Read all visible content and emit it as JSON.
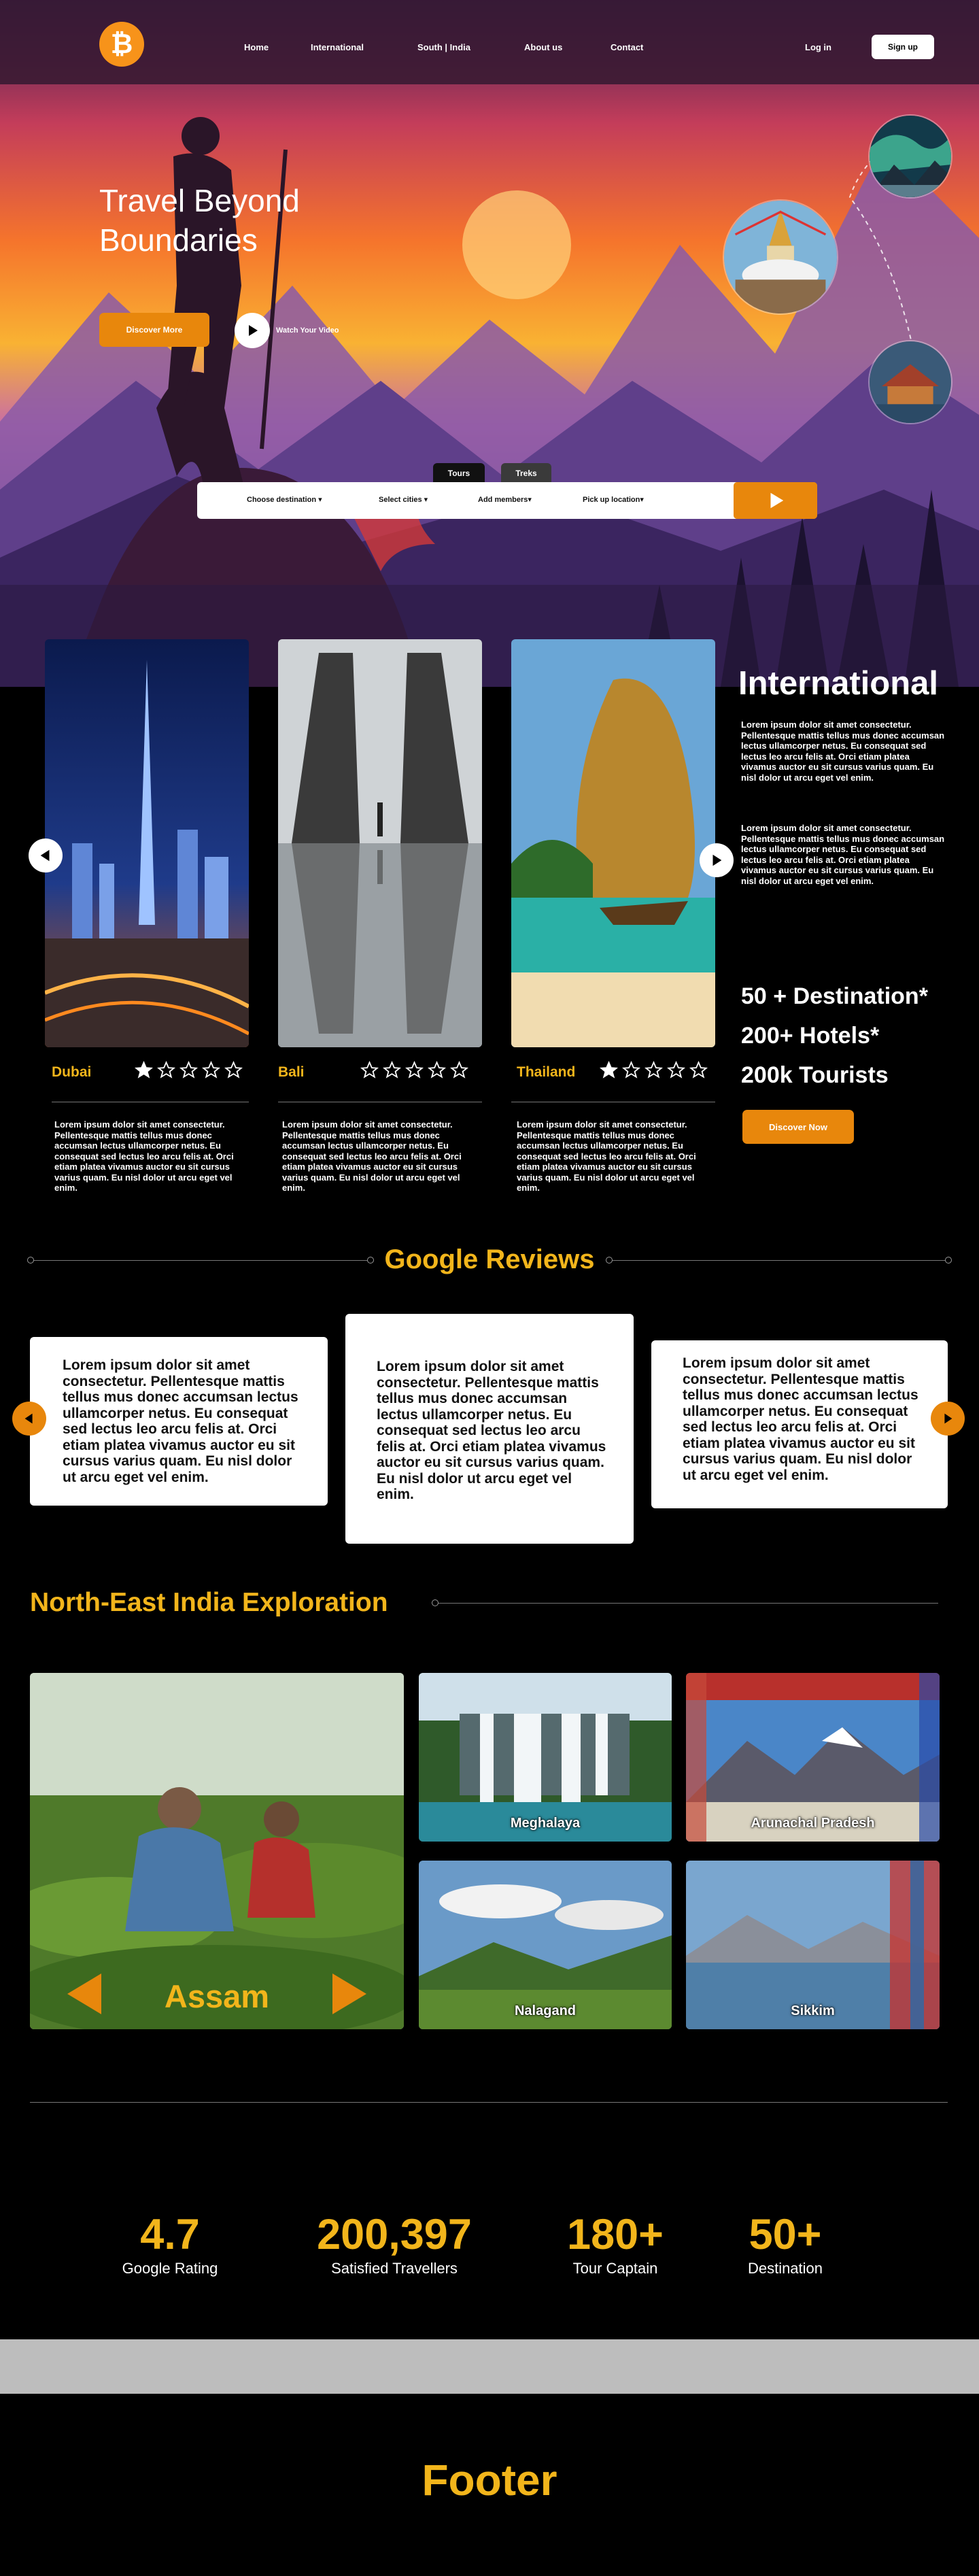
{
  "brand": {
    "logo_glyph": "₿",
    "accent": "#e8870c",
    "gold": "#f2b51b"
  },
  "nav": {
    "links": [
      "Home",
      "International",
      "South | India",
      "About us",
      "Contact"
    ],
    "login": "Log in",
    "signup": "Sign up"
  },
  "hero": {
    "title": "Travel Beyond Boundaries",
    "discover_label": "Discover More",
    "watch_label": "Watch Your Video",
    "play_icon": "play-icon"
  },
  "search": {
    "tabs": [
      "Tours",
      "Treks"
    ],
    "fields": [
      "Choose destination ▾",
      "Select cities ▾",
      "Add members▾",
      "Pick up location▾"
    ],
    "go_icon": "play-icon"
  },
  "destinations": [
    {
      "name": "Dubai",
      "rating": 1,
      "description": "Lorem ipsum dolor sit amet consectetur. Pellentesque mattis tellus mus donec accumsan lectus ullamcorper netus. Eu consequat sed lectus leo arcu felis at. Orci etiam platea vivamus auctor eu sit cursus varius quam. Eu nisl dolor ut arcu eget vel enim."
    },
    {
      "name": "Bali",
      "rating": 0,
      "description": "Lorem ipsum dolor sit amet consectetur. Pellentesque mattis tellus mus donec accumsan lectus ullamcorper netus. Eu consequat sed lectus leo arcu felis at. Orci etiam platea vivamus auctor eu sit cursus varius quam. Eu nisl dolor ut arcu eget vel enim."
    },
    {
      "name": "Thailand",
      "rating": 1,
      "description": "Lorem ipsum dolor sit amet consectetur. Pellentesque mattis tellus mus donec accumsan lectus ullamcorper netus. Eu consequat sed lectus leo arcu felis at. Orci etiam platea vivamus auctor eu sit cursus varius quam. Eu nisl dolor ut arcu eget vel enim."
    }
  ],
  "international": {
    "title": "International",
    "paragraphs": [
      "Lorem ipsum dolor sit amet consectetur. Pellentesque mattis tellus mus donec accumsan lectus ullamcorper netus. Eu consequat sed lectus leo arcu felis at. Orci etiam platea vivamus auctor eu sit cursus varius quam. Eu nisl dolor ut arcu eget vel enim.",
      "Lorem ipsum dolor sit amet consectetur. Pellentesque mattis tellus mus donec accumsan lectus ullamcorper netus. Eu consequat sed lectus leo arcu felis at. Orci etiam platea vivamus auctor eu sit cursus varius quam. Eu nisl dolor ut arcu eget vel enim."
    ],
    "stats": [
      "50 + Destination*",
      "200+ Hotels*",
      "200k Tourists"
    ],
    "cta": "Discover Now"
  },
  "reviews": {
    "title": "Google Reviews",
    "items": [
      "Lorem ipsum dolor sit amet consectetur. Pellentesque mattis tellus mus donec accumsan lectus ullamcorper netus. Eu consequat sed lectus leo arcu felis at. Orci etiam platea vivamus auctor eu sit cursus varius quam. Eu nisl dolor ut arcu eget vel enim.",
      "Lorem ipsum dolor sit amet consectetur. Pellentesque mattis tellus mus donec accumsan lectus ullamcorper netus. Eu consequat sed lectus leo arcu felis at. Orci etiam platea vivamus auctor eu sit cursus varius quam. Eu nisl dolor ut arcu eget vel enim.",
      "Lorem ipsum dolor sit amet consectetur. Pellentesque mattis tellus mus donec accumsan lectus ullamcorper netus. Eu consequat sed lectus leo arcu felis at. Orci etiam platea vivamus auctor eu sit cursus varius quam. Eu nisl dolor ut arcu eget vel enim."
    ]
  },
  "northeast": {
    "title": "North-East India Exploration",
    "featured": "Assam",
    "states": [
      "Meghalaya",
      "Arunachal Pradesh",
      "Nalagand",
      "Sikkim"
    ]
  },
  "stats": [
    {
      "value": "4.7",
      "label": "Google Rating"
    },
    {
      "value": "200,397",
      "label": "Satisfied Travellers"
    },
    {
      "value": "180+",
      "label": "Tour Captain"
    },
    {
      "value": "50+",
      "label": "Destination"
    }
  ],
  "footer": {
    "label": "Footer"
  }
}
